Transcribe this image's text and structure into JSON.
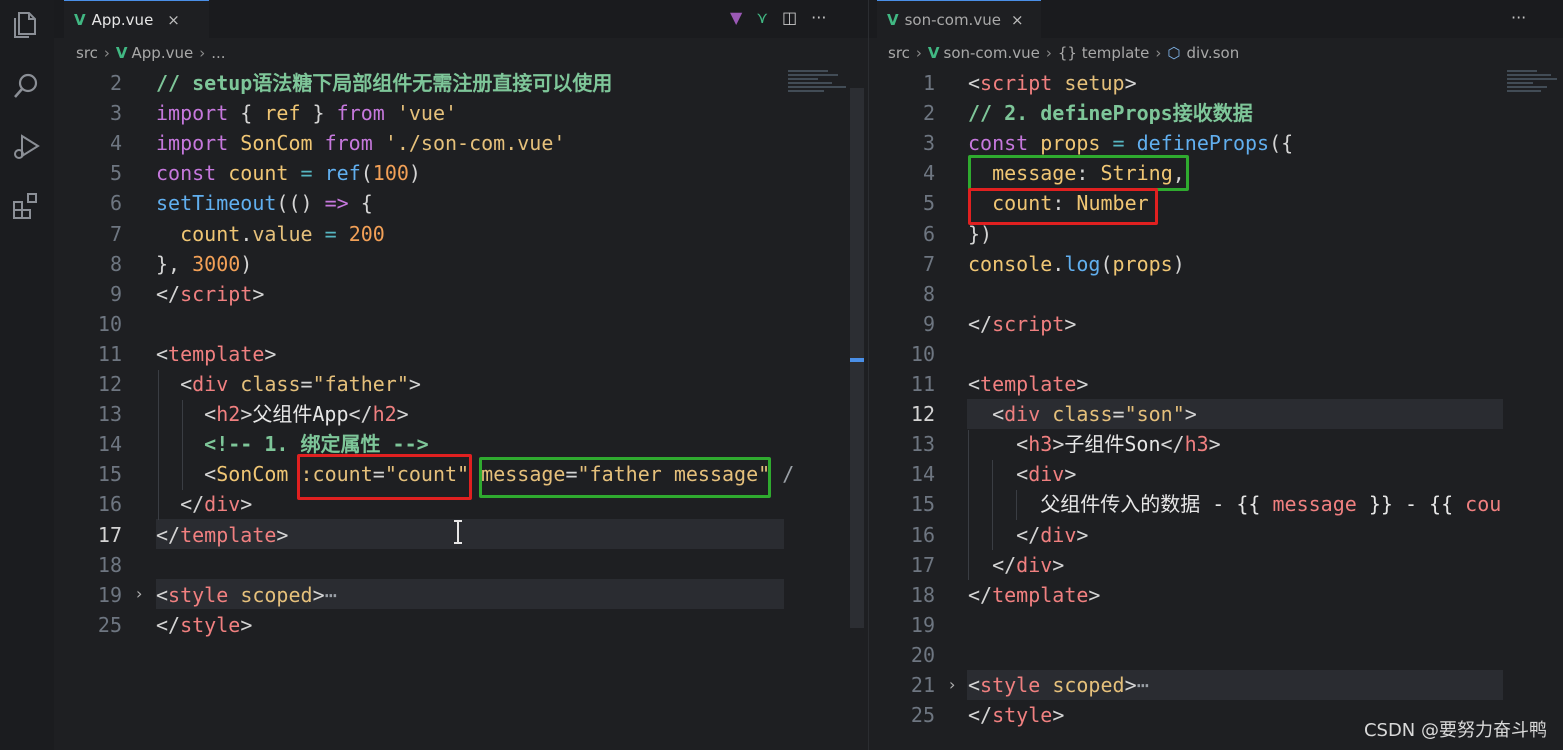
{
  "left_pane": {
    "tab_label": "App.vue",
    "tab_close": "×",
    "breadcrumb": [
      "src",
      "App.vue",
      "..."
    ],
    "tab_actions": [
      "▼",
      "⋎",
      "◫",
      "···"
    ],
    "lines": [
      {
        "n": "2",
        "tokens": [
          {
            "c": "cm",
            "t": "// setup语法糖下局部组件无需注册直接可以使用"
          }
        ]
      },
      {
        "n": "3",
        "tokens": [
          {
            "c": "kw",
            "t": "import"
          },
          {
            "c": "pn",
            "t": " { "
          },
          {
            "c": "var",
            "t": "ref"
          },
          {
            "c": "pn",
            "t": " } "
          },
          {
            "c": "kw",
            "t": "from"
          },
          {
            "c": "pn",
            "t": " "
          },
          {
            "c": "str",
            "t": "'vue'"
          }
        ]
      },
      {
        "n": "4",
        "tokens": [
          {
            "c": "kw",
            "t": "import"
          },
          {
            "c": "pn",
            "t": " "
          },
          {
            "c": "var",
            "t": "SonCom"
          },
          {
            "c": "pn",
            "t": " "
          },
          {
            "c": "kw",
            "t": "from"
          },
          {
            "c": "pn",
            "t": " "
          },
          {
            "c": "str",
            "t": "'./son-com.vue'"
          }
        ]
      },
      {
        "n": "5",
        "tokens": [
          {
            "c": "kw",
            "t": "const"
          },
          {
            "c": "pn",
            "t": " "
          },
          {
            "c": "var",
            "t": "count"
          },
          {
            "c": "pn",
            "t": " "
          },
          {
            "c": "op",
            "t": "="
          },
          {
            "c": "pn",
            "t": " "
          },
          {
            "c": "fn",
            "t": "ref"
          },
          {
            "c": "pn",
            "t": "("
          },
          {
            "c": "num",
            "t": "100"
          },
          {
            "c": "pn",
            "t": ")"
          }
        ]
      },
      {
        "n": "6",
        "tokens": [
          {
            "c": "fn",
            "t": "setTimeout"
          },
          {
            "c": "pn",
            "t": "(() "
          },
          {
            "c": "kw",
            "t": "=>"
          },
          {
            "c": "pn",
            "t": " {"
          }
        ]
      },
      {
        "n": "7",
        "tokens": [
          {
            "c": "pn",
            "t": "  "
          },
          {
            "c": "var",
            "t": "count"
          },
          {
            "c": "pn",
            "t": "."
          },
          {
            "c": "attr",
            "t": "value"
          },
          {
            "c": "pn",
            "t": " "
          },
          {
            "c": "op",
            "t": "="
          },
          {
            "c": "pn",
            "t": " "
          },
          {
            "c": "num",
            "t": "200"
          }
        ]
      },
      {
        "n": "8",
        "tokens": [
          {
            "c": "pn",
            "t": "}, "
          },
          {
            "c": "num",
            "t": "3000"
          },
          {
            "c": "pn",
            "t": ")"
          }
        ]
      },
      {
        "n": "9",
        "tokens": [
          {
            "c": "pn",
            "t": "</"
          },
          {
            "c": "tag",
            "t": "script"
          },
          {
            "c": "pn",
            "t": ">"
          }
        ]
      },
      {
        "n": "10",
        "tokens": []
      },
      {
        "n": "11",
        "tokens": [
          {
            "c": "pn",
            "t": "<"
          },
          {
            "c": "tag",
            "t": "template"
          },
          {
            "c": "pn",
            "t": ">"
          }
        ]
      },
      {
        "n": "12",
        "tokens": [
          {
            "c": "pn",
            "t": "  <"
          },
          {
            "c": "tag",
            "t": "div"
          },
          {
            "c": "pn",
            "t": " "
          },
          {
            "c": "attr",
            "t": "class"
          },
          {
            "c": "pn",
            "t": "="
          },
          {
            "c": "str",
            "t": "\"father\""
          },
          {
            "c": "pn",
            "t": ">"
          }
        ]
      },
      {
        "n": "13",
        "tokens": [
          {
            "c": "pn",
            "t": "    <"
          },
          {
            "c": "tag",
            "t": "h2"
          },
          {
            "c": "pn",
            "t": ">"
          },
          {
            "c": "plain",
            "t": "父组件App"
          },
          {
            "c": "pn",
            "t": "</"
          },
          {
            "c": "tag",
            "t": "h2"
          },
          {
            "c": "pn",
            "t": ">"
          }
        ]
      },
      {
        "n": "14",
        "tokens": [
          {
            "c": "pn",
            "t": "    "
          },
          {
            "c": "cm",
            "t": "<!-- 1. 绑定属性 -->"
          }
        ]
      },
      {
        "n": "15",
        "tokens": [
          {
            "c": "pn",
            "t": "    <"
          },
          {
            "c": "var",
            "t": "SonCom"
          },
          {
            "c": "pn",
            "t": " "
          },
          {
            "c": "attr",
            "t": ":count"
          },
          {
            "c": "pn",
            "t": "="
          },
          {
            "c": "str",
            "t": "\"count\""
          },
          {
            "c": "pn",
            "t": " "
          },
          {
            "c": "attr",
            "t": "message"
          },
          {
            "c": "pn",
            "t": "="
          },
          {
            "c": "str",
            "t": "\"father message\""
          },
          {
            "c": "dim",
            "t": " /"
          }
        ]
      },
      {
        "n": "16",
        "tokens": [
          {
            "c": "pn",
            "t": "  </"
          },
          {
            "c": "tag",
            "t": "div"
          },
          {
            "c": "pn",
            "t": ">"
          }
        ]
      },
      {
        "n": "17",
        "tokens": [
          {
            "c": "pn",
            "t": "</"
          },
          {
            "c": "tag",
            "t": "template"
          },
          {
            "c": "pn",
            "t": ">"
          }
        ]
      },
      {
        "n": "18",
        "tokens": []
      },
      {
        "n": "19",
        "tokens": [
          {
            "c": "pn",
            "t": "<"
          },
          {
            "c": "tag",
            "t": "style"
          },
          {
            "c": "pn",
            "t": " "
          },
          {
            "c": "attr",
            "t": "scoped"
          },
          {
            "c": "pn",
            "t": ">"
          },
          {
            "c": "dim",
            "t": "⋯"
          }
        ]
      },
      {
        "n": "25",
        "tokens": [
          {
            "c": "pn",
            "t": "</"
          },
          {
            "c": "tag",
            "t": "style"
          },
          {
            "c": "pn",
            "t": ">"
          }
        ]
      }
    ]
  },
  "right_pane": {
    "tab_label": "son-com.vue",
    "tab_close": "×",
    "breadcrumb": [
      "src",
      "son-com.vue",
      "{} template",
      "div.son"
    ],
    "tab_actions": [
      "···"
    ],
    "lines": [
      {
        "n": "1",
        "tokens": [
          {
            "c": "pn",
            "t": "<"
          },
          {
            "c": "tag",
            "t": "script"
          },
          {
            "c": "pn",
            "t": " "
          },
          {
            "c": "attr",
            "t": "setup"
          },
          {
            "c": "pn",
            "t": ">"
          }
        ]
      },
      {
        "n": "2",
        "tokens": [
          {
            "c": "cm",
            "t": "// 2. defineProps接收数据"
          }
        ]
      },
      {
        "n": "3",
        "tokens": [
          {
            "c": "kw",
            "t": "const"
          },
          {
            "c": "pn",
            "t": " "
          },
          {
            "c": "var",
            "t": "props"
          },
          {
            "c": "pn",
            "t": " "
          },
          {
            "c": "op",
            "t": "="
          },
          {
            "c": "pn",
            "t": " "
          },
          {
            "c": "fn",
            "t": "defineProps"
          },
          {
            "c": "pn",
            "t": "({"
          }
        ]
      },
      {
        "n": "4",
        "tokens": [
          {
            "c": "pn",
            "t": "  "
          },
          {
            "c": "var",
            "t": "message"
          },
          {
            "c": "pn",
            "t": ": "
          },
          {
            "c": "var",
            "t": "String"
          },
          {
            "c": "pn",
            "t": ","
          }
        ]
      },
      {
        "n": "5",
        "tokens": [
          {
            "c": "pn",
            "t": "  "
          },
          {
            "c": "var",
            "t": "count"
          },
          {
            "c": "pn",
            "t": ": "
          },
          {
            "c": "var",
            "t": "Number"
          }
        ]
      },
      {
        "n": "6",
        "tokens": [
          {
            "c": "pn",
            "t": "})"
          }
        ]
      },
      {
        "n": "7",
        "tokens": [
          {
            "c": "var",
            "t": "console"
          },
          {
            "c": "pn",
            "t": "."
          },
          {
            "c": "fn",
            "t": "log"
          },
          {
            "c": "pn",
            "t": "("
          },
          {
            "c": "var",
            "t": "props"
          },
          {
            "c": "pn",
            "t": ")"
          }
        ]
      },
      {
        "n": "8",
        "tokens": []
      },
      {
        "n": "9",
        "tokens": [
          {
            "c": "pn",
            "t": "</"
          },
          {
            "c": "tag",
            "t": "script"
          },
          {
            "c": "pn",
            "t": ">"
          }
        ]
      },
      {
        "n": "10",
        "tokens": []
      },
      {
        "n": "11",
        "tokens": [
          {
            "c": "pn",
            "t": "<"
          },
          {
            "c": "tag",
            "t": "template"
          },
          {
            "c": "pn",
            "t": ">"
          }
        ]
      },
      {
        "n": "12",
        "tokens": [
          {
            "c": "pn",
            "t": "  <"
          },
          {
            "c": "tag",
            "t": "div"
          },
          {
            "c": "pn",
            "t": " "
          },
          {
            "c": "attr",
            "t": "class"
          },
          {
            "c": "pn",
            "t": "="
          },
          {
            "c": "str",
            "t": "\"son\""
          },
          {
            "c": "pn",
            "t": ">"
          }
        ]
      },
      {
        "n": "13",
        "tokens": [
          {
            "c": "pn",
            "t": "    <"
          },
          {
            "c": "tag",
            "t": "h3"
          },
          {
            "c": "pn",
            "t": ">"
          },
          {
            "c": "plain",
            "t": "子组件Son"
          },
          {
            "c": "pn",
            "t": "</"
          },
          {
            "c": "tag",
            "t": "h3"
          },
          {
            "c": "pn",
            "t": ">"
          }
        ]
      },
      {
        "n": "14",
        "tokens": [
          {
            "c": "pn",
            "t": "    <"
          },
          {
            "c": "tag",
            "t": "div"
          },
          {
            "c": "pn",
            "t": ">"
          }
        ]
      },
      {
        "n": "15",
        "tokens": [
          {
            "c": "pn",
            "t": "      "
          },
          {
            "c": "plain",
            "t": "父组件传入的数据 - {{ "
          },
          {
            "c": "tag",
            "t": "message"
          },
          {
            "c": "plain",
            "t": " }} - {{ "
          },
          {
            "c": "tag",
            "t": "cou"
          }
        ]
      },
      {
        "n": "16",
        "tokens": [
          {
            "c": "pn",
            "t": "    </"
          },
          {
            "c": "tag",
            "t": "div"
          },
          {
            "c": "pn",
            "t": ">"
          }
        ]
      },
      {
        "n": "17",
        "tokens": [
          {
            "c": "pn",
            "t": "  </"
          },
          {
            "c": "tag",
            "t": "div"
          },
          {
            "c": "pn",
            "t": ">"
          }
        ]
      },
      {
        "n": "18",
        "tokens": [
          {
            "c": "pn",
            "t": "</"
          },
          {
            "c": "tag",
            "t": "template"
          },
          {
            "c": "pn",
            "t": ">"
          }
        ]
      },
      {
        "n": "19",
        "tokens": []
      },
      {
        "n": "20",
        "tokens": []
      },
      {
        "n": "21",
        "tokens": [
          {
            "c": "pn",
            "t": "<"
          },
          {
            "c": "tag",
            "t": "style"
          },
          {
            "c": "pn",
            "t": " "
          },
          {
            "c": "attr",
            "t": "scoped"
          },
          {
            "c": "pn",
            "t": ">"
          },
          {
            "c": "dim",
            "t": "⋯"
          }
        ]
      },
      {
        "n": "25",
        "tokens": [
          {
            "c": "pn",
            "t": "</"
          },
          {
            "c": "tag",
            "t": "style"
          },
          {
            "c": "pn",
            "t": ">"
          }
        ]
      }
    ]
  },
  "activity_icons": [
    "explorer-icon",
    "search-icon",
    "run-debug-icon",
    "extensions-icon"
  ],
  "watermark": "CSDN @要努力奋斗鸭"
}
